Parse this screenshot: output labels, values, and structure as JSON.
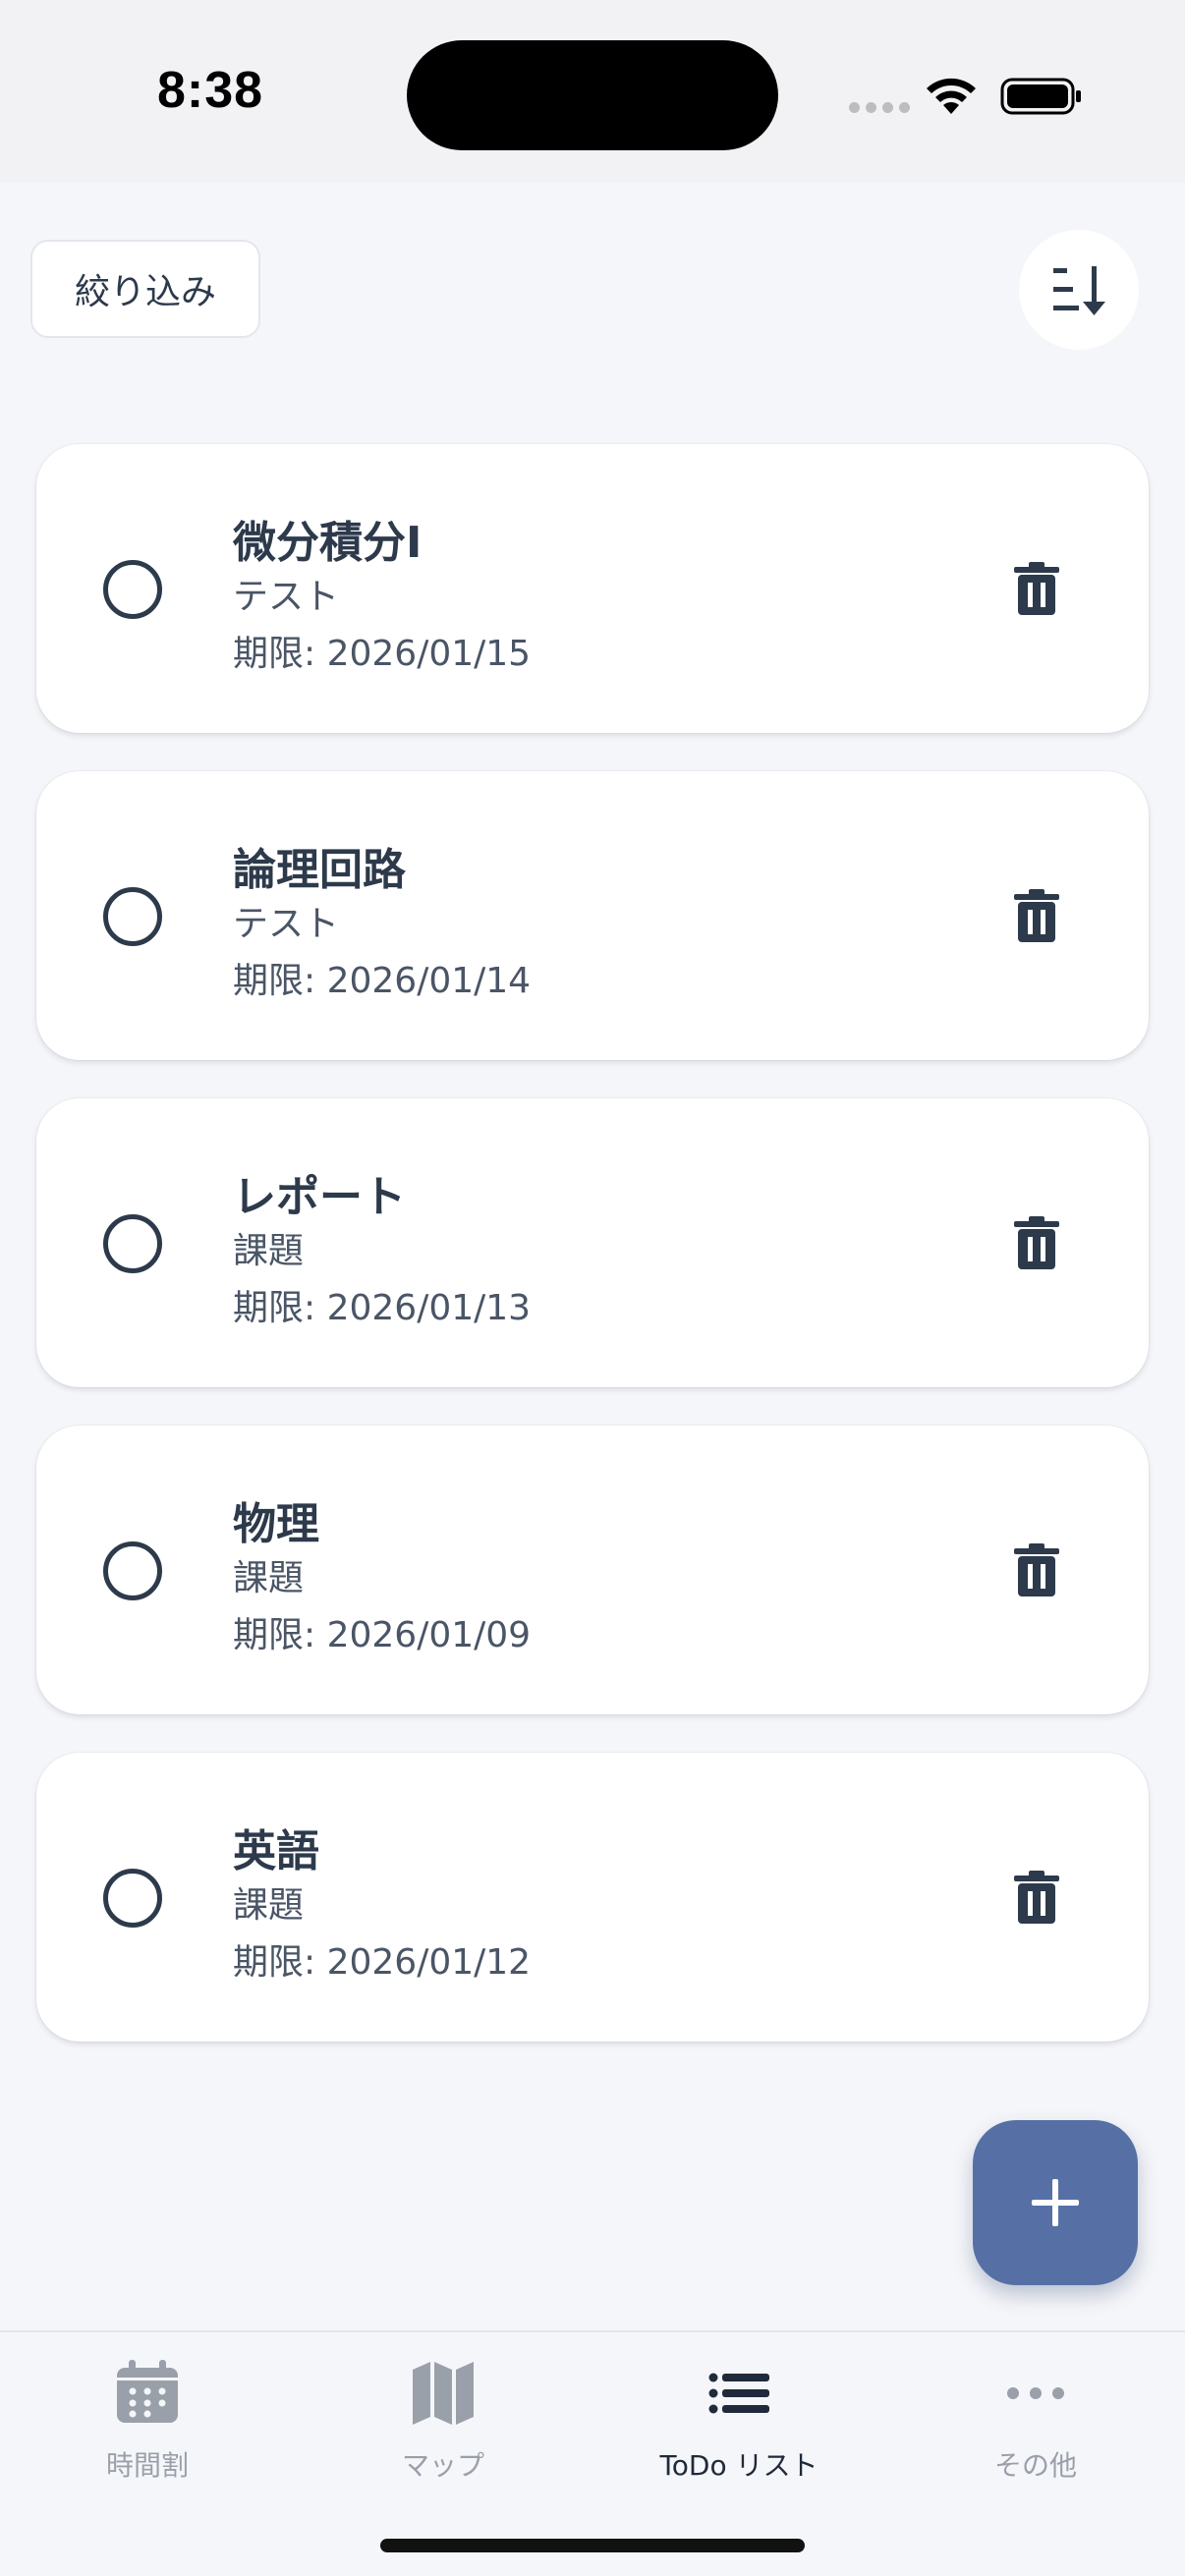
{
  "status_bar": {
    "time": "8:38"
  },
  "header": {
    "filter_label": "絞り込み",
    "sort_icon": "sort-descending-icon"
  },
  "todos": [
    {
      "title": "微分積分I",
      "type": "テスト",
      "due": "期限: 2026/01/15"
    },
    {
      "title": "論理回路",
      "type": "テスト",
      "due": "期限: 2026/01/14"
    },
    {
      "title": "レポート",
      "type": "課題",
      "due": "期限: 2026/01/13"
    },
    {
      "title": "物理",
      "type": "課題",
      "due": "期限: 2026/01/09"
    },
    {
      "title": "英語",
      "type": "課題",
      "due": "期限: 2026/01/12"
    }
  ],
  "fab": {
    "icon": "plus-icon"
  },
  "bottom_nav": {
    "items": [
      {
        "label": "時間割",
        "icon": "calendar-icon",
        "active": false
      },
      {
        "label": "マップ",
        "icon": "map-icon",
        "active": false
      },
      {
        "label": "ToDo リスト",
        "icon": "list-icon",
        "active": true
      },
      {
        "label": "その他",
        "icon": "more-icon",
        "active": false
      }
    ]
  },
  "colors": {
    "background": "#f5f6f9",
    "text_primary": "#2d3a4b",
    "accent": "#5670a6",
    "nav_inactive": "#9aa0aa"
  }
}
